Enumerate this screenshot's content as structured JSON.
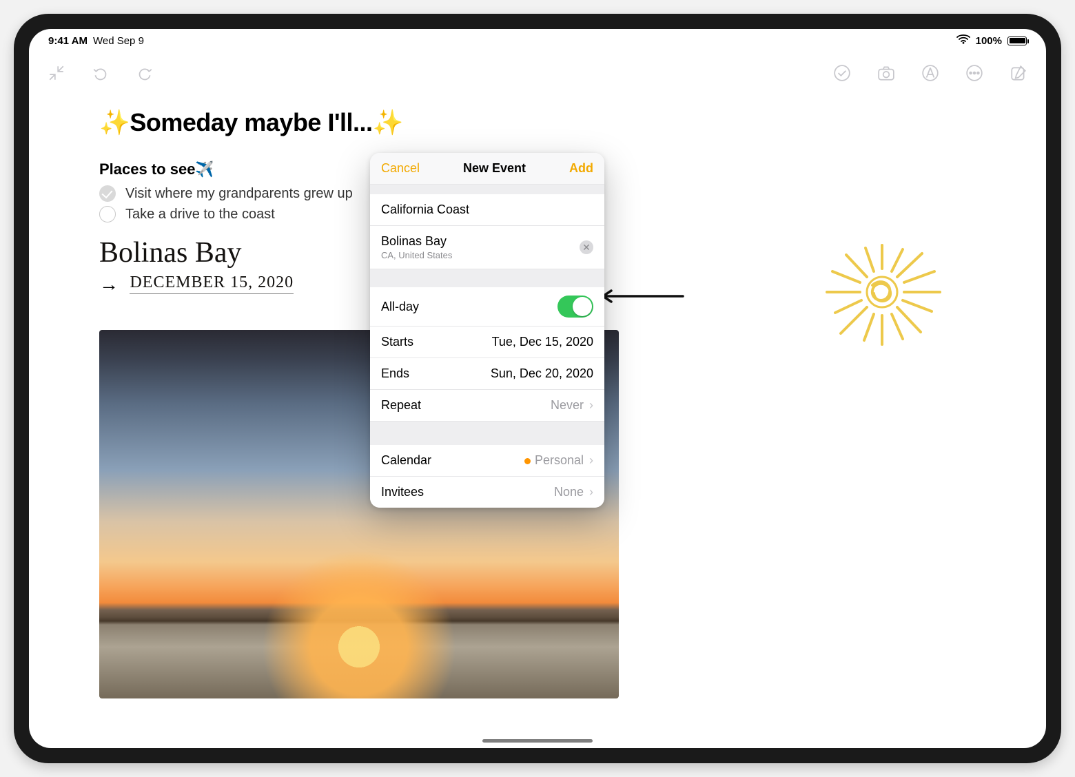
{
  "statusbar": {
    "time": "9:41 AM",
    "date": "Wed Sep 9",
    "battery_pct": "100%"
  },
  "note": {
    "title": "✨Someday maybe I'll...✨",
    "section_places": "Places to see✈️",
    "check1": "Visit where my grandparents grew up",
    "check2": "Take a drive to the coast",
    "hw_name": "Bolinas Bay",
    "hw_date": "DECEMBER 15, 2020"
  },
  "popover": {
    "cancel": "Cancel",
    "title": "New Event",
    "add": "Add",
    "event_title": "California Coast",
    "location": "Bolinas Bay",
    "location_sub": "CA, United States",
    "allday_label": "All-day",
    "allday_on": true,
    "starts_label": "Starts",
    "starts_value": "Tue, Dec 15, 2020",
    "ends_label": "Ends",
    "ends_value": "Sun, Dec 20, 2020",
    "repeat_label": "Repeat",
    "repeat_value": "Never",
    "calendar_label": "Calendar",
    "calendar_value": "Personal",
    "invitees_label": "Invitees",
    "invitees_value": "None"
  }
}
